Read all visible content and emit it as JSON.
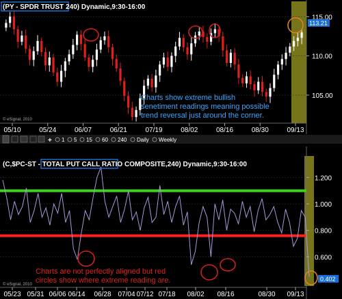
{
  "top_panel": {
    "title": "(PY - SPDR TRUST 240) Dynamic,9:30-16:00",
    "title_parts": {
      "symbol": "(PY",
      "name": "- SPDR TRUST",
      "suffix": "240) Dynamic,9:30-16:00"
    },
    "annotation": [
      "Charts show extreme bullish",
      "senetiment readings meaning possible",
      "trend reversal just around the corner."
    ],
    "watermark": "© eSignal, 2010",
    "last_value_label": "113.21",
    "colors": {
      "up": "#ffffff",
      "down": "#e02020",
      "annotation": "#3aa6ff",
      "highlight_box": "#1a6fd6",
      "circle": "#d02020",
      "shade": "#8b8a1d"
    }
  },
  "toolbar": {
    "items": [
      "+",
      "1",
      "5",
      "15",
      "60",
      "240",
      "Daily",
      "Weekly"
    ]
  },
  "bottom_panel": {
    "title": "(C,$PC-ST - TOTAL PUT CALL RATIO COMPOSITE,240) Dynamic,9:30-16:00",
    "title_parts": {
      "prefix": "(C,$PC-ST - ",
      "name": "TOTAL PUT CALL RATIO",
      "suffix": " COMPOSITE,240) Dynamic,9:30-16:00"
    },
    "annotation": [
      "Charts are not perfectly aligned but red",
      "circles show where extreme reading are."
    ],
    "watermark": "© eSignal, 2010",
    "last_value_label": "0.402",
    "colors": {
      "line": "#a89ad8",
      "upper_band": "#3bd21a",
      "lower_band": "#ff2020",
      "annotation": "#e02020",
      "circle": "#d02020",
      "shade": "#8b8a1d"
    }
  },
  "chart_data": [
    {
      "type": "candlestick",
      "title": "(PY - SPDR TRUST 240) Dynamic,9:30-16:00",
      "x_ticks": [
        "05/10",
        "05/24",
        "06/07",
        "06/21",
        "07/19",
        "08/02",
        "08/16",
        "08/30",
        "09/13"
      ],
      "y_ticks": [
        105,
        110,
        115
      ],
      "ylim": [
        101.6,
        116.6
      ],
      "last_value": 113.21,
      "series": [
        {
          "values": [
            114.2,
            115.0,
            113.4,
            111.8,
            112.6,
            110.9,
            109.5,
            110.6,
            111.9,
            110.5,
            108.8,
            109.8,
            107.9,
            106.7,
            108.1,
            109.3,
            110.2,
            111.4,
            112.7,
            111.5,
            109.8,
            108.6,
            109.5,
            110.8,
            112.0,
            112.5,
            111.1,
            109.6,
            108.4,
            106.8,
            104.9,
            103.4,
            102.2,
            103.1,
            104.6,
            106.2,
            107.1,
            106.0,
            107.5,
            108.9,
            109.8,
            108.6,
            110.0,
            111.2,
            112.3,
            111.1,
            110.2,
            111.6,
            112.6,
            113.1,
            112.4,
            111.8,
            112.9,
            113.4,
            112.5,
            110.7,
            109.1,
            110.4,
            108.9,
            107.2,
            106.5,
            107.4,
            106.4,
            105.6,
            106.7,
            105.4,
            104.8,
            105.9,
            107.6,
            108.9,
            109.6,
            110.4,
            111.2,
            111.9,
            112.3,
            113.0
          ]
        }
      ],
      "annotation": "Charts show extreme bullish senetiment readings meaning possible trend reversal just around the corner."
    },
    {
      "type": "line",
      "title": "(C,$PC-ST - TOTAL PUT CALL RATIO COMPOSITE,240) Dynamic,9:30-16:00",
      "x_ticks": [
        "05/23",
        "05/31",
        "06/06",
        "06/14",
        "06/28",
        "07/04",
        "07/12",
        "07/18",
        "08/02",
        "08/16",
        "08/30",
        "09/13"
      ],
      "y_ticks": [
        0.6,
        0.8,
        1.0,
        1.2
      ],
      "ylim": [
        0.38,
        1.3
      ],
      "last_value": 0.402,
      "reference_lines": [
        {
          "value": 1.1,
          "color": "#3bd21a"
        },
        {
          "value": 0.76,
          "color": "#ff2020"
        }
      ],
      "series": [
        {
          "values": [
            1.18,
            1.05,
            0.88,
            1.02,
            0.92,
            0.98,
            1.12,
            0.86,
            0.95,
            1.08,
            0.9,
            0.97,
            0.84,
            1.0,
            0.93,
            1.08,
            0.86,
            0.95,
            0.66,
            0.58,
            0.78,
            0.95,
            0.88,
            1.05,
            1.2,
            1.28,
            1.02,
            0.9,
            0.98,
            1.06,
            0.86,
            0.96,
            1.1,
            0.88,
            0.94,
            0.8,
            0.97,
            1.05,
            0.86,
            0.9,
            1.14,
            0.92,
            1.02,
            0.86,
            0.98,
            1.06,
            0.84,
            0.94,
            0.54,
            0.64,
            0.86,
            0.98,
            0.9,
            0.6,
            1.0,
            0.88,
            1.03,
            0.8,
            0.96,
            0.93,
            0.85,
            1.02,
            0.9,
            0.98,
            0.79,
            0.95,
            1.04,
            0.88,
            0.92,
            0.98,
            0.86,
            0.78,
            0.96,
            0.86,
            0.68,
            0.74,
            0.95,
            0.9,
            0.45
          ]
        }
      ],
      "annotation": "Charts are not perfectly aligned but red circles show where extreme reading are."
    }
  ]
}
